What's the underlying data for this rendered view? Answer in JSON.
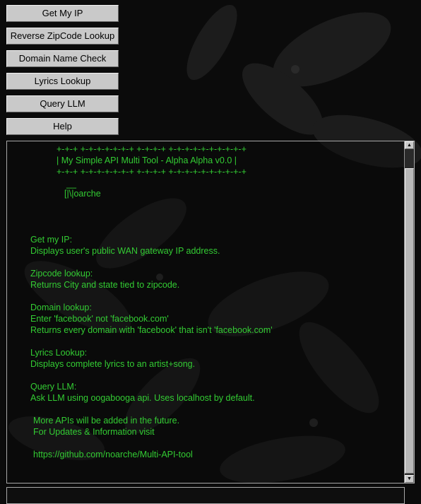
{
  "buttons": {
    "get_ip": "Get My IP",
    "reverse_zip": "Reverse ZipCode Lookup",
    "domain_check": "Domain Name Check",
    "lyrics": "Lyrics Lookup",
    "query_llm": "Query LLM",
    "help": "Help"
  },
  "console": {
    "banner_top": "+-+-+ +-+-+-+-+-+-+ +-+-+-+ +-+-+-+-+-+-+-+-+-+",
    "banner_title": "| My Simple API Multi Tool - Alpha Alpha v0.0 |",
    "banner_bottom": "+-+-+ +-+-+-+-+-+-+ +-+-+-+ +-+-+-+-+-+-+-+-+-+",
    "author_mark": "__",
    "author": "[|\\|oarche",
    "help_get_ip_title": "Get my IP:",
    "help_get_ip_desc": "Displays user's public WAN gateway IP address.",
    "help_zip_title": "Zipcode lookup:",
    "help_zip_desc": "Returns City and state tied to zipcode.",
    "help_domain_title": "Domain lookup:",
    "help_domain_desc1": "Enter 'facebook' not 'facebook.com'",
    "help_domain_desc2": "Returns every domain with 'facebook' that isn't 'facebook.com'",
    "help_lyrics_title": "Lyrics Lookup:",
    "help_lyrics_desc": "Displays complete lyrics to an artist+song.",
    "help_llm_title": "Query LLM:",
    "help_llm_desc": "Ask LLM using oogabooga api. Uses localhost by default.",
    "more_apis": "More APIs will be added in the future.",
    "updates": "For Updates & Information visit",
    "url": "https://github.com/noarche/Multi-API-tool"
  },
  "colors": {
    "console_text": "#33cc33",
    "button_face": "#c9c9c9",
    "background": "#0b0b0b"
  },
  "scrollbar": {
    "up_icon": "scroll-up-arrow-icon",
    "down_icon": "scroll-down-arrow-icon"
  }
}
